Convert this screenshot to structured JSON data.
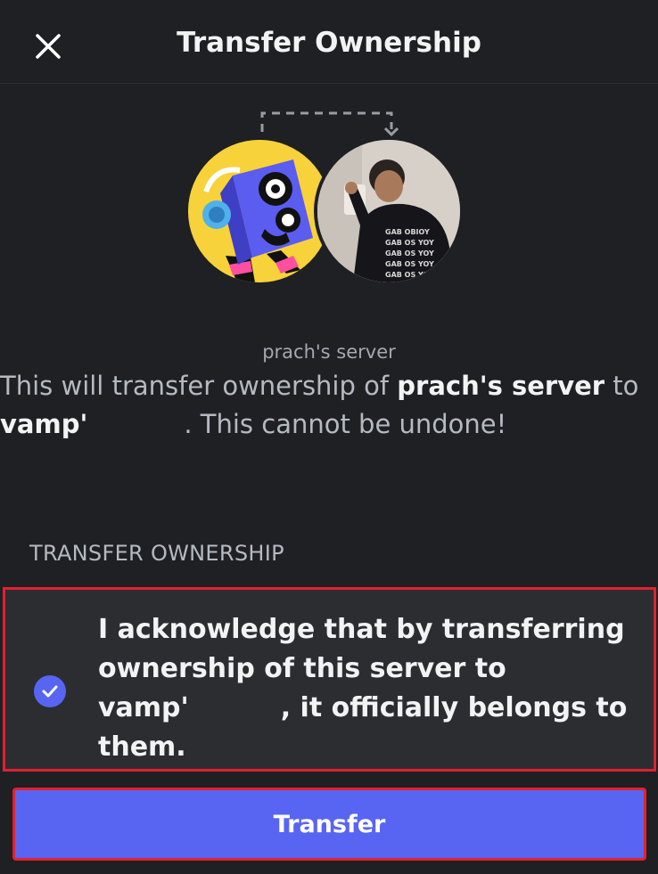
{
  "header": {
    "title": "Transfer Ownership",
    "close_icon": "close-icon"
  },
  "transfer_graphic": {
    "arrow_icon": "dashed-transfer-arrow-icon",
    "owner_avatar": "speaker-character-avatar",
    "new_owner_avatar": "user-photo-avatar"
  },
  "server": {
    "name": "prach's server"
  },
  "description": {
    "prefix": "This will transfer ownership of ",
    "server_name": "prach's server",
    "middle": " to",
    "username": "vamp'",
    "suffix": ". This cannot be undone!"
  },
  "section": {
    "label": "TRANSFER OWNERSHIP"
  },
  "acknowledgement": {
    "checked": true,
    "line1": "I acknowledge that by transferring",
    "line2": "ownership of this server to",
    "username": "vamp'",
    "line3_suffix": ", it officially belongs to",
    "line4": "them."
  },
  "actions": {
    "transfer_label": "Transfer"
  },
  "colors": {
    "background": "#1f2023",
    "accent": "#5865f2",
    "highlight_border": "#e2202f"
  }
}
